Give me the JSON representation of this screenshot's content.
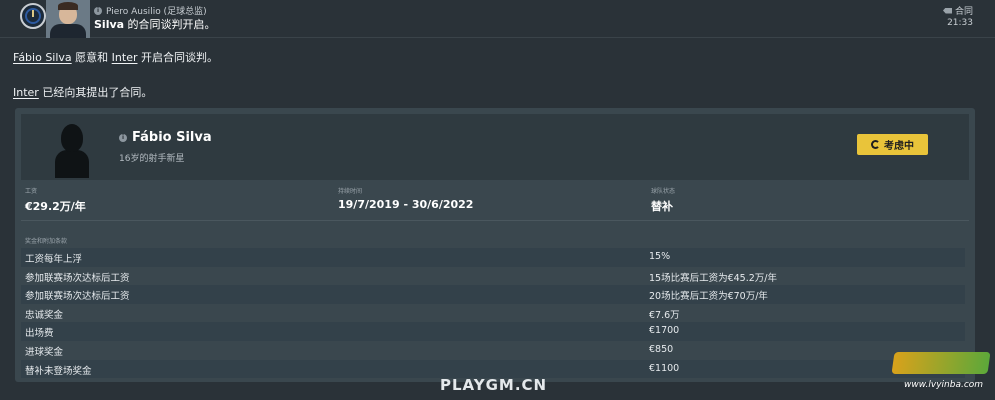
{
  "header": {
    "sender": "Piero Ausilio (足球总监)",
    "subject_name": "Silva",
    "subject_rest": " 的合同谈判开启。",
    "category": "合同",
    "time": "21:33"
  },
  "messages": {
    "line1": {
      "player_link": "Fábio Silva",
      "mid": " 愿意和 ",
      "club_link": "Inter",
      "end": " 开启合同谈判。"
    },
    "line2": {
      "club_link": "Inter",
      "end": " 已经向其提出了合同。"
    }
  },
  "card": {
    "player_name": "Fábio Silva",
    "player_subtitle": "16岁的射手新星",
    "status_label": "考虑中",
    "terms": {
      "wage_label": "工资",
      "wage_value": "€29.2万/年",
      "duration_label": "持续时间",
      "duration_value": "19/7/2019 - 30/6/2022",
      "squad_label": "球队状态",
      "squad_value": "替补"
    },
    "bonus_title": "奖金和附加条款",
    "bonuses": [
      {
        "key": "工资每年上浮",
        "value": "15%"
      },
      {
        "key": "参加联赛场次达标后工资",
        "value": "15场比赛后工资为€45.2万/年"
      },
      {
        "key": "参加联赛场次达标后工资",
        "value": "20场比赛后工资为€70万/年"
      },
      {
        "key": "忠诚奖金",
        "value": "€7.6万"
      },
      {
        "key": "出场费",
        "value": "€1700"
      },
      {
        "key": "进球奖金",
        "value": "€850"
      },
      {
        "key": "替补未登场奖金",
        "value": "€1100"
      }
    ]
  },
  "watermarks": {
    "main": "PLAYGM.CN",
    "corner_url": "www.lvyinba.com"
  },
  "colors": {
    "accent_yellow": "#e9c43a",
    "background": "#2a3238",
    "card": "#3a474e"
  }
}
